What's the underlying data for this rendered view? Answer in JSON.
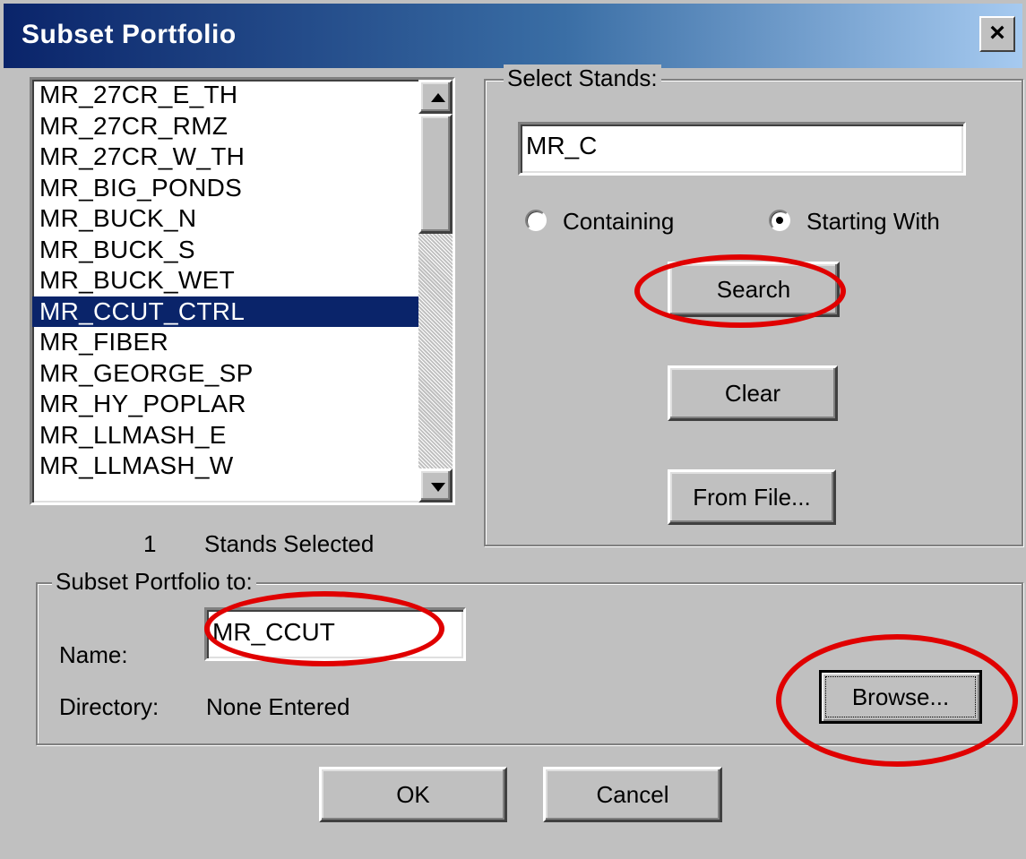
{
  "window": {
    "title": "Subset Portfolio",
    "close_glyph": "×"
  },
  "stands_list": {
    "items": [
      "MR_27CR_E_TH",
      "MR_27CR_RMZ",
      "MR_27CR_W_TH",
      "MR_BIG_PONDS",
      "MR_BUCK_N",
      "MR_BUCK_S",
      "MR_BUCK_WET",
      "MR_CCUT_CTRL",
      "MR_FIBER",
      "MR_GEORGE_SP",
      "MR_HY_POPLAR",
      "MR_LLMASH_E",
      "MR_LLMASH_W"
    ],
    "selected_index": 7,
    "selected_count": "1",
    "selected_label": "Stands Selected"
  },
  "select_stands": {
    "legend": "Select Stands:",
    "search_value": "MR_C",
    "radio_containing": "Containing",
    "radio_starting_with": "Starting With",
    "selected_option": "Starting With",
    "search_button": "Search",
    "clear_button": "Clear",
    "from_file_button": "From File..."
  },
  "subset_to": {
    "legend": "Subset Portfolio to:",
    "name_label": "Name:",
    "name_value": "MR_CCUT",
    "directory_label": "Directory:",
    "directory_value": "None Entered",
    "browse_button": "Browse..."
  },
  "footer": {
    "ok_button": "OK",
    "cancel_button": "Cancel"
  },
  "annotation": {
    "highlight_color": "#e00000"
  }
}
